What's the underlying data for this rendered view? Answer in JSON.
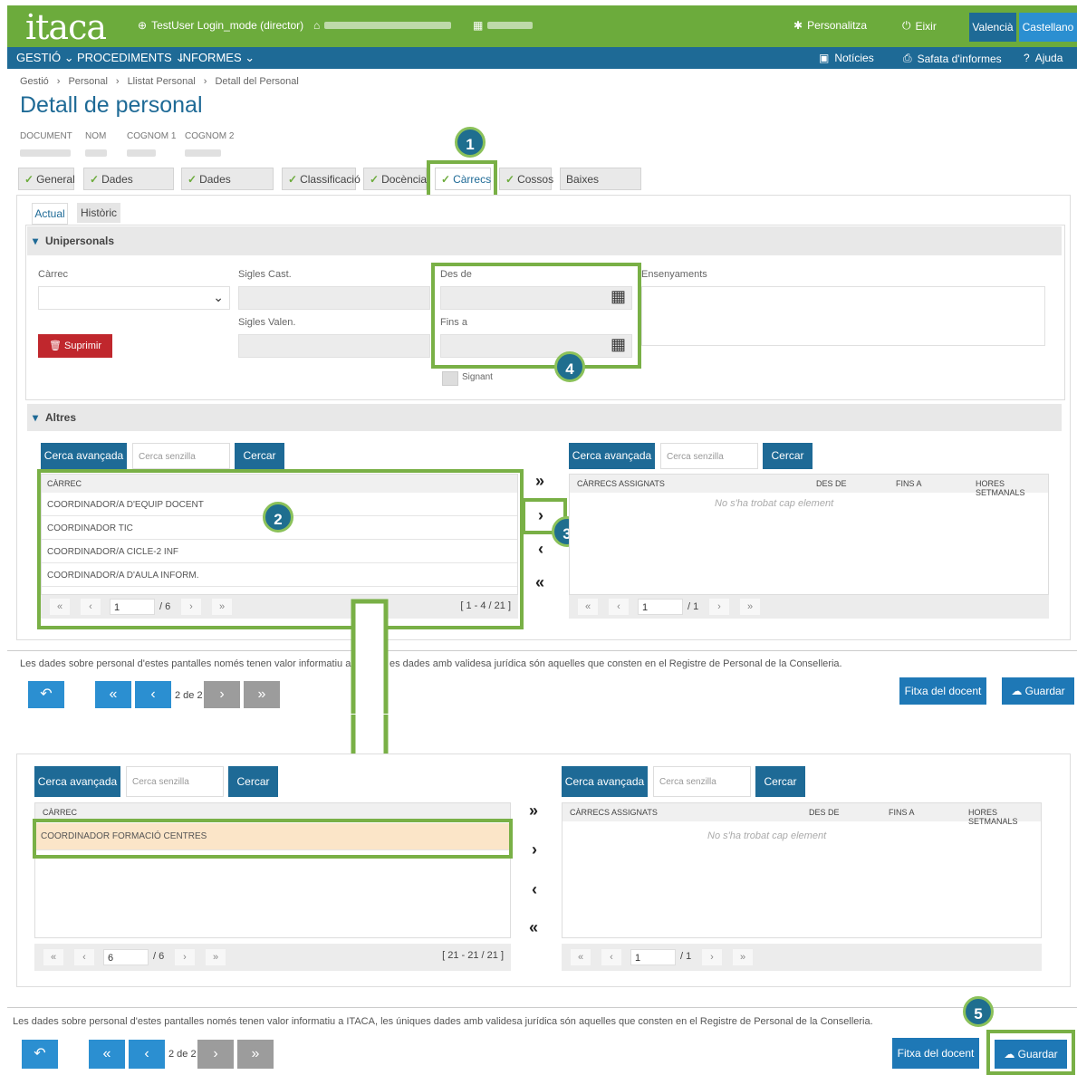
{
  "header": {
    "logo": "itaca",
    "user": "TestUser Login_mode (director)",
    "personalize": "Personalitza",
    "exit": "Eixir",
    "lang_valencian": "Valencià",
    "lang_spanish": "Castellano"
  },
  "nav": {
    "gestio": "GESTIÓ",
    "procediments": "PROCEDIMENTS",
    "informes": "INFORMES",
    "noticies": "Notícies",
    "safata": "Safata d'informes",
    "ajuda": "Ajuda"
  },
  "breadcrumb": [
    "Gestió",
    "Personal",
    "Llistat Personal",
    "Detall del Personal"
  ],
  "title": "Detall de personal",
  "person_fields": [
    "DOCUMENT",
    "NOM",
    "COGNOM 1",
    "COGNOM 2"
  ],
  "tabs": [
    {
      "label": "General",
      "ok": true
    },
    {
      "label": "Dades Contacte",
      "ok": true
    },
    {
      "label": "Dades Bancàries",
      "ok": true
    },
    {
      "label": "Classificació",
      "ok": true
    },
    {
      "label": "Docència",
      "ok": true
    },
    {
      "label": "Càrrecs",
      "ok": true
    },
    {
      "label": "Cossos",
      "ok": true
    },
    {
      "label": "Baixes Mèdiques",
      "ok": false
    }
  ],
  "subtabs": [
    "Actual",
    "Històric"
  ],
  "unipersonals": {
    "title": "Unipersonals",
    "carrec_label": "Càrrec",
    "sigles_cast": "Sigles Cast.",
    "sigles_valen": "Sigles Valen.",
    "des_de": "Des de",
    "fins_a": "Fins a",
    "ensenyaments": "Ensenyaments",
    "signant": "Signant",
    "delete": "Suprimir"
  },
  "altres": {
    "title": "Altres",
    "advanced": "Cerca avançada",
    "simple_placeholder": "Cerca senzilla",
    "search": "Cercar",
    "left_header": "CÀRREC",
    "left_rows": [
      "COORDINADOR/A D'EQUIP DOCENT",
      "COORDINADOR TIC",
      "COORDINADOR/A CICLE-2 INF",
      "COORDINADOR/A D'AULA INFORM."
    ],
    "left_page": "1",
    "left_pages": "/ 6",
    "left_range": "[ 1 - 4 / 21 ]",
    "right_headers": [
      "CÀRRECS ASSIGNATS",
      "DES DE",
      "FINS A",
      "HORES SETMANALS"
    ],
    "empty": "No s'ha trobat cap element",
    "right_page": "1",
    "right_pages": "/ 1"
  },
  "second": {
    "left_header": "CÀRREC",
    "left_rows": [
      "COORDINADOR FORMACIÓ CENTRES"
    ],
    "left_page": "6",
    "left_pages": "/ 6",
    "left_range": "[ 21 - 21 / 21 ]"
  },
  "footer": {
    "notice_short_a": "Les dades sobre personal d'estes pantalles només tenen valor informatiu a ITACA,",
    "notice_short_b": "es dades amb validesa jurídica són aquelles que consten en el Registre de Personal de la Conselleria.",
    "notice_full": "Les dades sobre personal d'estes pantalles només tenen valor informatiu a ITACA, les úniques dades amb validesa jurídica són aquelles que consten en el Registre de Personal de la Conselleria.",
    "page_info": "2 de 2",
    "fitxa": "Fitxa del docent",
    "guardar": "Guardar"
  },
  "badges": [
    "1",
    "2",
    "3",
    "4",
    "5"
  ],
  "colors": {
    "green": "#6cab3c",
    "blue": "#1e6a96",
    "highlight": "#79b046"
  }
}
